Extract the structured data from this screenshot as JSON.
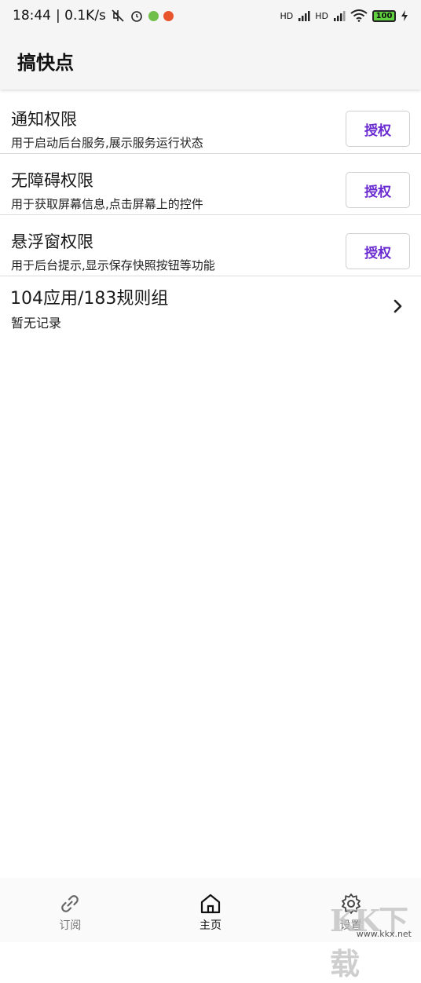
{
  "status_bar": {
    "time": "18:44",
    "network_speed": "| 0.1K/s",
    "battery": "100",
    "hd1": "HD",
    "hd2": "HD"
  },
  "app_bar": {
    "title": "搞快点"
  },
  "permissions": [
    {
      "title": "通知权限",
      "desc": "用于启动后台服务,展示服务运行状态",
      "button": "授权"
    },
    {
      "title": "无障碍权限",
      "desc": "用于获取屏幕信息,点击屏幕上的控件",
      "button": "授权"
    },
    {
      "title": "悬浮窗权限",
      "desc": "用于后台提示,显示保存快照按钮等功能",
      "button": "授权"
    }
  ],
  "rules": {
    "title": "104应用/183规则组",
    "desc": "暂无记录"
  },
  "bottom_nav": [
    {
      "label": "订阅",
      "icon": "link-icon",
      "active": false
    },
    {
      "label": "主页",
      "icon": "home-icon",
      "active": true
    },
    {
      "label": "设置",
      "icon": "gear-icon",
      "active": false
    }
  ],
  "watermark": {
    "logo": "KK下载",
    "site": "www.kkx.net"
  },
  "colors": {
    "accent": "#6a2bd0",
    "divider": "#dcdcdc",
    "bar_bg": "#f5f5f5"
  }
}
